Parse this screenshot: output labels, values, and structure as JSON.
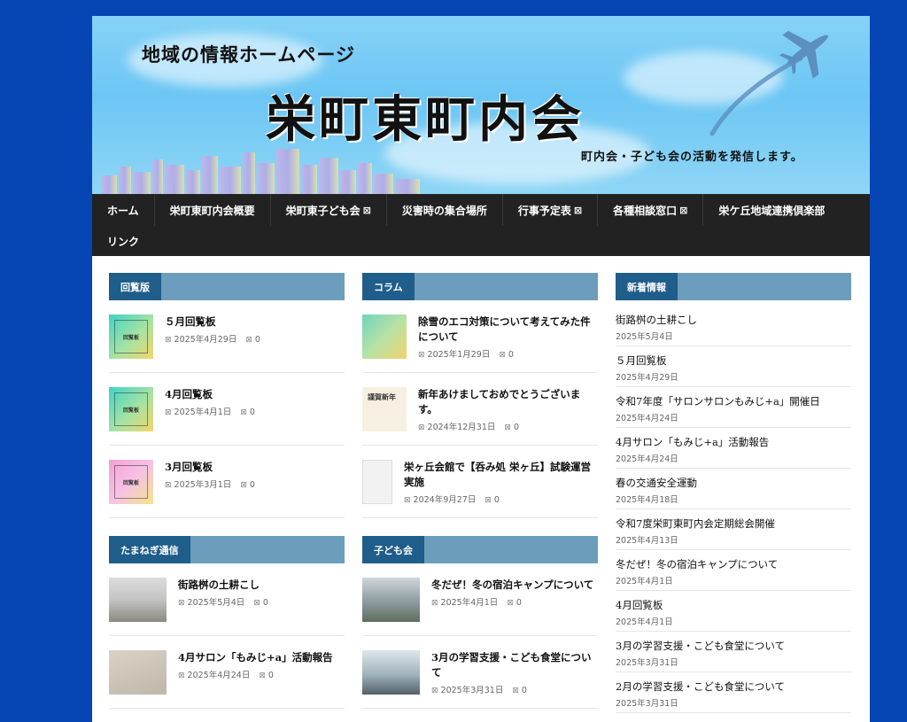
{
  "header": {
    "tagline": "地域の情報ホームページ",
    "title": "栄町東町内会",
    "subtitle": "町内会・子ども会の活動を発信します。"
  },
  "nav": {
    "row1": [
      {
        "label": "ホーム",
        "caret": ""
      },
      {
        "label": "栄町東町内会概要",
        "caret": ""
      },
      {
        "label": "栄町東子ども会",
        "caret": "⊠"
      },
      {
        "label": "災害時の集合場所",
        "caret": ""
      },
      {
        "label": "行事予定表",
        "caret": "⊠"
      },
      {
        "label": "各種相談窓口",
        "caret": "⊠"
      },
      {
        "label": "栄ケ丘地域連携倶楽部",
        "caret": ""
      }
    ],
    "row2": [
      {
        "label": "リンク"
      }
    ]
  },
  "sections": {
    "kairanban": {
      "label": "回覧版",
      "posts": [
        {
          "title": "５月回覧板",
          "date": "2025年4月29日",
          "comments": "0",
          "thumb_text": "回覧板"
        },
        {
          "title": "4月回覧板",
          "date": "2025年4月1日",
          "comments": "0",
          "thumb_text": "回覧板"
        },
        {
          "title": "3月回覧板",
          "date": "2025年3月1日",
          "comments": "0",
          "thumb_text": "回覧板"
        }
      ]
    },
    "column": {
      "label": "コラム",
      "posts": [
        {
          "title": "除雪のエコ対策について考えてみた件について",
          "date": "2025年1月29日",
          "comments": "0"
        },
        {
          "title": "新年あけましておめでとうございます。",
          "date": "2024年12月31日",
          "comments": "0",
          "thumb_text": "謹賀新年"
        },
        {
          "title": "栄ヶ丘会館で【呑み処 栄ヶ丘】試験運営実施",
          "date": "2024年9月27日",
          "comments": "0"
        }
      ]
    },
    "tamanegi": {
      "label": "たまねぎ通信",
      "posts": [
        {
          "title": "街路桝の土耕こし",
          "date": "2025年5月4日",
          "comments": "0"
        },
        {
          "title": "4月サロン「もみじ+a」活動報告",
          "date": "2025年4月24日",
          "comments": "0"
        }
      ]
    },
    "kodomo": {
      "label": "子ども会",
      "posts": [
        {
          "title": "冬だぜ！冬の宿泊キャンプについて",
          "date": "2025年4月1日",
          "comments": "0"
        },
        {
          "title": "3月の学習支援・こども食堂について",
          "date": "2025年3月31日",
          "comments": "0"
        }
      ]
    }
  },
  "sidebar": {
    "label": "新着情報",
    "items": [
      {
        "title": "街路桝の土耕こし",
        "date": "2025年5月4日"
      },
      {
        "title": "５月回覧板",
        "date": "2025年4月29日"
      },
      {
        "title": "令和7年度「サロンサロンもみじ+a」開催日",
        "date": "2025年4月24日"
      },
      {
        "title": "4月サロン「もみじ+a」活動報告",
        "date": "2025年4月24日"
      },
      {
        "title": "春の交通安全運動",
        "date": "2025年4月18日"
      },
      {
        "title": "令和7度栄町東町内会定期総会開催",
        "date": "2025年4月13日"
      },
      {
        "title": "冬だぜ！冬の宿泊キャンプについて",
        "date": "2025年4月1日"
      },
      {
        "title": "4月回覧板",
        "date": "2025年4月1日"
      },
      {
        "title": "3月の学習支援・こども食堂について",
        "date": "2025年3月31日"
      },
      {
        "title": "2月の学習支援・こども食堂について",
        "date": "2025年3月31日"
      }
    ]
  },
  "meta_icons": {
    "date": "⊠",
    "comment": "⊠"
  }
}
